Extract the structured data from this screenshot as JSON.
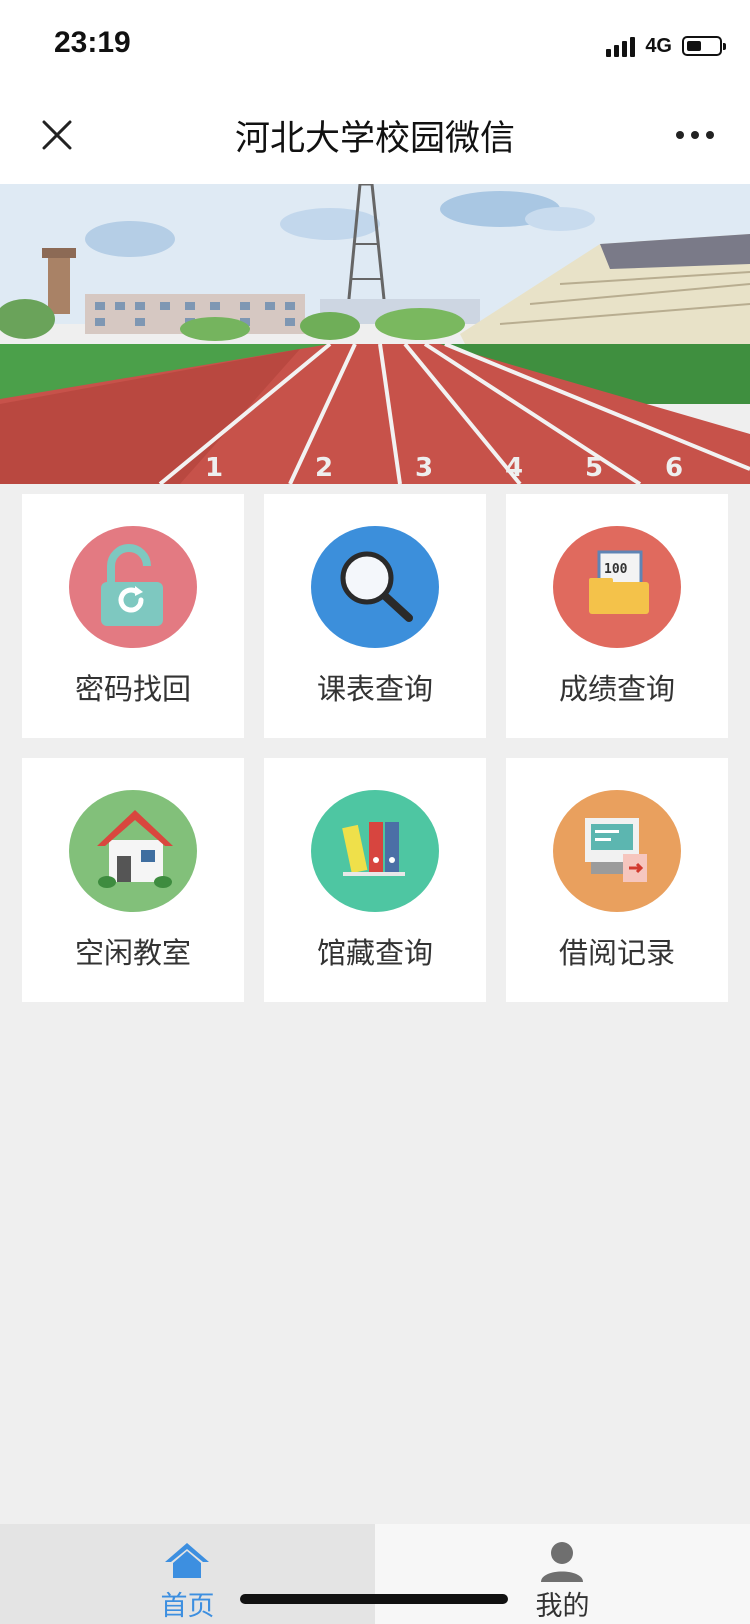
{
  "status_bar": {
    "time": "23:19",
    "network": "4G"
  },
  "nav": {
    "title": "河北大学校园微信",
    "close_icon": "close-icon",
    "more_icon": "more-icon"
  },
  "banner": {
    "icon": "campus-track-painting"
  },
  "grid": [
    {
      "label": "密码找回",
      "icon": "unlock-refresh-icon",
      "color": "#e37a82"
    },
    {
      "label": "课表查询",
      "icon": "magnifier-icon",
      "color": "#3c8fdb"
    },
    {
      "label": "成绩查询",
      "icon": "score-folder-icon",
      "color": "#e06a5e",
      "badge": "100"
    },
    {
      "label": "空闲教室",
      "icon": "house-icon",
      "color": "#82c07a"
    },
    {
      "label": "馆藏查询",
      "icon": "binders-icon",
      "color": "#4ec6a2"
    },
    {
      "label": "借阅记录",
      "icon": "borrow-record-icon",
      "color": "#e9a05e"
    }
  ],
  "tabs": [
    {
      "label": "首页",
      "icon": "home-icon",
      "active": true,
      "color": "#3d8fe0"
    },
    {
      "label": "我的",
      "icon": "user-icon",
      "active": false
    }
  ]
}
